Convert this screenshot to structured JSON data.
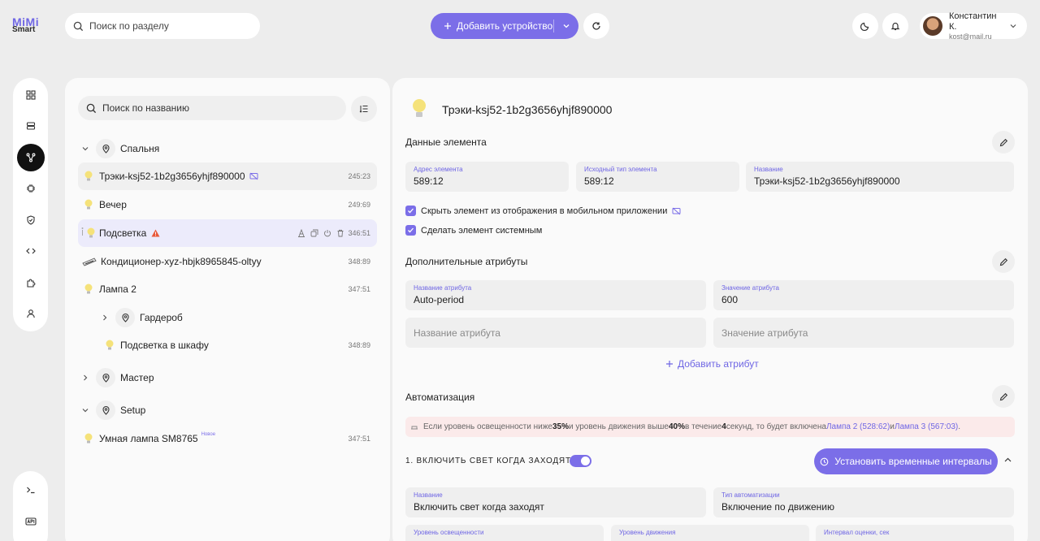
{
  "brand": {
    "line1": "MiMi",
    "line2": "Smart"
  },
  "header": {
    "search_placeholder": "Поиск по разделу",
    "add_device_label": "Добавить устройство",
    "user_name": "Константин К.",
    "user_email": "kost@mail.ru"
  },
  "tree": {
    "search_placeholder": "Поиск по названию",
    "rows": [
      {
        "label": "Спальня"
      },
      {
        "label": "Трэки-ksj52-1b2g3656yhjf890000",
        "time": "245:23"
      },
      {
        "label": "Вечер",
        "time": "249:69"
      },
      {
        "label": "Подсветка",
        "time": "346:51"
      },
      {
        "label": "Кондиционер-xyz-hbjk8965845-oltyy",
        "time": "348:89"
      },
      {
        "label": "Лампа 2",
        "time": "347:51"
      },
      {
        "label": "Гардероб"
      },
      {
        "label": "Подсветка в шкафу",
        "time": "348:89"
      },
      {
        "label": "Мастер"
      },
      {
        "label": "Setup"
      },
      {
        "label": "Умная лампа SM8765",
        "badge": "Новое",
        "time": "347:51"
      }
    ]
  },
  "device": {
    "title": "Трэки-ksj52-1b2g3656yhjf890000",
    "data_section": "Данные элемента",
    "address_caption": "Адрес элемента",
    "address_value": "589:12",
    "src_type_caption": "Исходный тип элемента",
    "src_type_value": "589:12",
    "name_caption": "Название",
    "name_value": "Трэки-ksj52-1b2g3656yhjf890000",
    "hide_label": "Скрыть элемент из отображения в мобильном приложении",
    "system_label": "Сделать элемент системным"
  },
  "attributes": {
    "section": "Дополнительные атрибуты",
    "name_caption": "Название атрибута",
    "name_value": "Auto-period",
    "value_caption": "Значение атрибута",
    "value_value": "600",
    "name_placeholder": "Название атрибута",
    "value_placeholder": "Значение атрибута",
    "add_label": "Добавить атрибут"
  },
  "automation": {
    "section": "Автоматизация",
    "alert": {
      "t1": "Если уровень освещенности ниже ",
      "b1": "35%",
      "t2": " и уровень движения выше ",
      "b2": "40%",
      "t3": " в течение ",
      "b3": "4",
      "t4": " секунд, то будет включена ",
      "l1": "Лампа 2 (528:62)",
      "t5": " и ",
      "l2": "Лампа 3 (567:03)",
      "t6": "."
    },
    "rule_title": "1. ВКЛЮЧИТЬ СВЕТ КОГДА ЗАХОДЯТ",
    "interval_button": "Установить временные интервалы",
    "name_caption": "Название",
    "name_value": "Включить свет когда заходят",
    "type_caption": "Тип автоматизации",
    "type_value": "Включение по движению",
    "light_caption": "Уровень освещенности",
    "motion_caption": "Уровень движения",
    "interval_caption": "Интервал оценки, сек"
  },
  "colors": {
    "accent": "#7b6ee8",
    "warning": "#e8583a",
    "alert_bg": "#fbeaea"
  }
}
